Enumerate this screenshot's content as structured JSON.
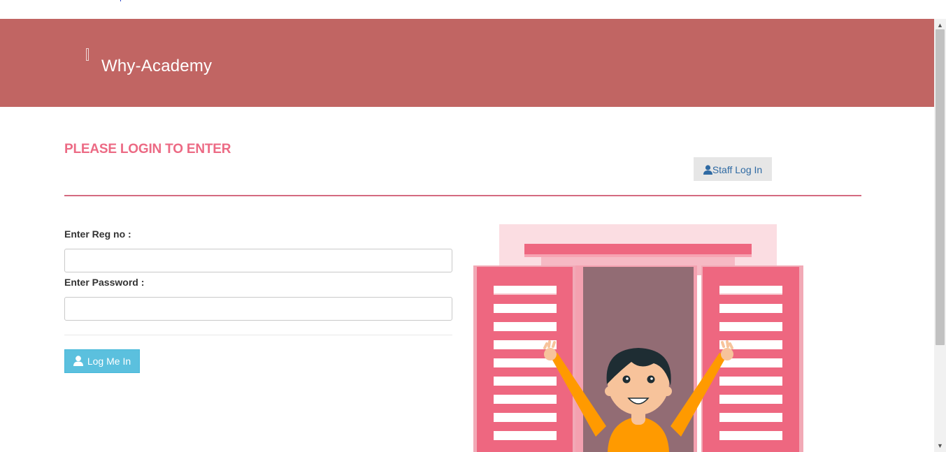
{
  "header": {
    "brand": "Why-Academy",
    "menu_icon": "menu-icon"
  },
  "main": {
    "heading": "PLEASE LOGIN TO ENTER",
    "staff_button": {
      "label": "Staff Log In",
      "icon": "user-icon"
    },
    "form": {
      "reg_label": "Enter Reg no :",
      "reg_value": "",
      "password_label": "Enter Password :",
      "password_value": "",
      "submit_label": "Log Me In",
      "submit_icon": "user-icon"
    },
    "illustration": "person-waving-from-window"
  },
  "colors": {
    "header_bg": "#c16563",
    "accent": "#ec6a84",
    "primary_button": "#5bc0de",
    "link": "#2f6aa3"
  }
}
